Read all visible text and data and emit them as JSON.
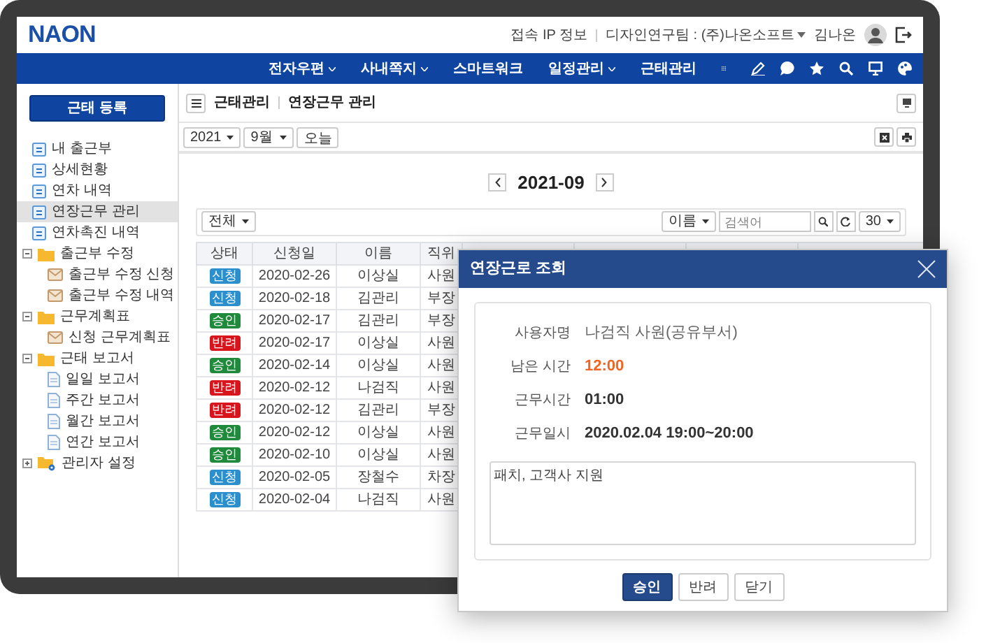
{
  "top_bar": {
    "logo": "NAON",
    "ip_info": "접속 IP 정보",
    "organization": "디자인연구팀 : (주)나온소프트",
    "user_name": "김나온"
  },
  "nav": {
    "items": [
      {
        "label": "전자우편",
        "dropdown": true
      },
      {
        "label": "사내쪽지",
        "dropdown": true
      },
      {
        "label": "스마트워크",
        "dropdown": false
      },
      {
        "label": "일정관리",
        "dropdown": true
      },
      {
        "label": "근태관리",
        "dropdown": false
      }
    ]
  },
  "sidebar": {
    "register_button": "근태 등록",
    "items": [
      {
        "kind": "page",
        "label": "내 출근부",
        "selected": false
      },
      {
        "kind": "page",
        "label": "상세현황",
        "selected": false
      },
      {
        "kind": "page",
        "label": "연차 내역",
        "selected": false
      },
      {
        "kind": "page",
        "label": "연장근무 관리",
        "selected": true
      },
      {
        "kind": "page",
        "label": "연차촉진 내역",
        "selected": false
      },
      {
        "kind": "folder",
        "label": "출근부 수정",
        "selected": false,
        "expanded": true,
        "children": [
          {
            "kind": "form",
            "label": "출근부 수정 신청",
            "selected": false
          },
          {
            "kind": "form",
            "label": "출근부 수정 내역",
            "selected": false
          }
        ]
      },
      {
        "kind": "folder",
        "label": "근무계획표",
        "selected": false,
        "expanded": true,
        "children": [
          {
            "kind": "form",
            "label": "신청 근무계획표",
            "selected": false
          }
        ]
      },
      {
        "kind": "folder",
        "label": "근태 보고서",
        "selected": false,
        "expanded": true,
        "children": [
          {
            "kind": "report",
            "label": "일일 보고서",
            "selected": false
          },
          {
            "kind": "report",
            "label": "주간 보고서",
            "selected": false
          },
          {
            "kind": "report",
            "label": "월간 보고서",
            "selected": false
          },
          {
            "kind": "report",
            "label": "연간 보고서",
            "selected": false
          }
        ]
      },
      {
        "kind": "admin_folder",
        "label": "관리자 설정",
        "selected": false,
        "expanded": false
      }
    ]
  },
  "breadcrumb": [
    "근태관리",
    "연장근무 관리"
  ],
  "filters": {
    "year": "2021",
    "month": "9월",
    "today_button": "오늘"
  },
  "month_nav": {
    "label": "2021-09"
  },
  "table": {
    "filter": "전체",
    "search_option": "이름",
    "search_placeholder": "검색어",
    "page_size": "30",
    "columns": [
      "상태",
      "신청일",
      "이름",
      "직위"
    ],
    "rows": [
      {
        "status": "신청",
        "color": "#2b8fce",
        "date": "2020-02-26",
        "name": "이상실",
        "position": "사원"
      },
      {
        "status": "신청",
        "color": "#2b8fce",
        "date": "2020-02-18",
        "name": "김관리",
        "position": "부장"
      },
      {
        "status": "승인",
        "color": "#1f8a3b",
        "date": "2020-02-17",
        "name": "김관리",
        "position": "부장"
      },
      {
        "status": "반려",
        "color": "#d8141c",
        "date": "2020-02-17",
        "name": "이상실",
        "position": "사원"
      },
      {
        "status": "승인",
        "color": "#1f8a3b",
        "date": "2020-02-14",
        "name": "이상실",
        "position": "사원"
      },
      {
        "status": "반려",
        "color": "#d8141c",
        "date": "2020-02-12",
        "name": "나검직",
        "position": "사원"
      },
      {
        "status": "반려",
        "color": "#d8141c",
        "date": "2020-02-12",
        "name": "김관리",
        "position": "부장"
      },
      {
        "status": "승인",
        "color": "#1f8a3b",
        "date": "2020-02-12",
        "name": "이상실",
        "position": "사원"
      },
      {
        "status": "승인",
        "color": "#1f8a3b",
        "date": "2020-02-10",
        "name": "이상실",
        "position": "사원"
      },
      {
        "status": "신청",
        "color": "#2b8fce",
        "date": "2020-02-05",
        "name": "장철수",
        "position": "차장"
      },
      {
        "status": "신청",
        "color": "#2b8fce",
        "date": "2020-02-04",
        "name": "나검직",
        "position": "사원"
      }
    ]
  },
  "dialog": {
    "title": "연장근로 조회",
    "fields": [
      {
        "label": "사용자명",
        "value": "나검직 사원(공유부서)",
        "kind": "normal"
      },
      {
        "label": "남은 시간",
        "value": "12:00",
        "kind": "alert"
      },
      {
        "label": "근무시간",
        "value": "01:00",
        "kind": "bold"
      },
      {
        "label": "근무일시",
        "value": "2020.02.04 19:00~20:00",
        "kind": "bold"
      }
    ],
    "memo": "패치, 고객사 지원",
    "buttons": [
      {
        "label": "승인",
        "primary": true
      },
      {
        "label": "반려",
        "primary": false
      },
      {
        "label": "닫기",
        "primary": false
      }
    ]
  }
}
